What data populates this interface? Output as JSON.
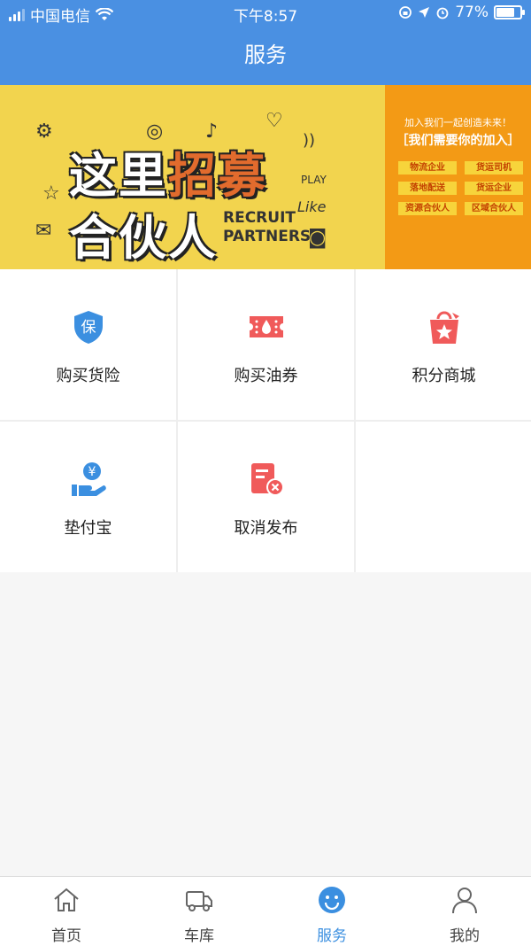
{
  "status_bar": {
    "carrier": "中国电信",
    "time": "下午8:57",
    "battery": "77%",
    "battery_level": 0.77
  },
  "header": {
    "title": "服务"
  },
  "banner": {
    "line1a": "这里",
    "line1b": "招募",
    "line2": "合伙人",
    "recruit_line1": "RECRUIT",
    "recruit_line2": "PARTNERS",
    "play": "PLAY",
    "like": "Like",
    "right_top": "加入我们一起创造未来！",
    "right_main": "［我们需要你的加入］",
    "tags": [
      "物流企业",
      "货运司机",
      "落地配送",
      "货运企业",
      "资源合伙人",
      "区域合伙人"
    ]
  },
  "services": [
    {
      "label": "购买货险",
      "icon": "insurance-shield-icon",
      "icon_char": "保"
    },
    {
      "label": "购买油券",
      "icon": "fuel-ticket-icon"
    },
    {
      "label": "积分商城",
      "icon": "shopping-bag-star-icon"
    },
    {
      "label": "垫付宝",
      "icon": "hand-yuan-coin-icon",
      "icon_char": "¥"
    },
    {
      "label": "取消发布",
      "icon": "document-cancel-icon"
    }
  ],
  "tabbar": {
    "items": [
      {
        "label": "首页",
        "icon": "home-icon"
      },
      {
        "label": "车库",
        "icon": "truck-icon"
      },
      {
        "label": "服务",
        "icon": "smiley-icon"
      },
      {
        "label": "我的",
        "icon": "user-icon"
      }
    ],
    "active": "服务",
    "active_color": "#3b8fe0"
  },
  "colors": {
    "header": "#4a90e2",
    "banner_left": "#f2d44e",
    "banner_right": "#f39a15",
    "red_icon": "#f05a5a",
    "blue_icon": "#3b8fe0"
  }
}
